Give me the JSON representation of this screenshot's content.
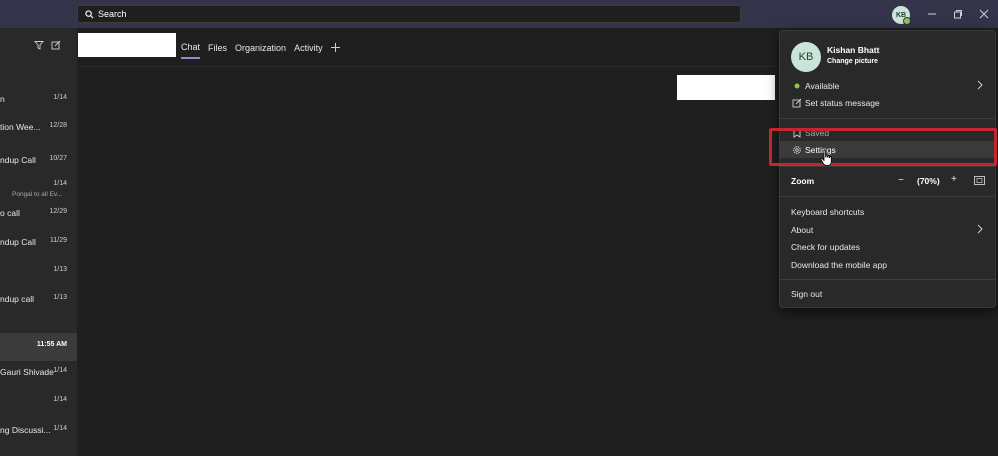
{
  "search": {
    "placeholder": "Search"
  },
  "header": {
    "avatar_initials": "KB"
  },
  "tabs": [
    {
      "label": "Chat",
      "active": true
    },
    {
      "label": "Files"
    },
    {
      "label": "Organization"
    },
    {
      "label": "Activity"
    }
  ],
  "chat_list": [
    {
      "name": "n",
      "date": "1/14"
    },
    {
      "name": "tion Wee...",
      "date": "12/28"
    },
    {
      "name": "ndup Call",
      "date": "10/27"
    },
    {
      "name": "",
      "date": "1/14",
      "preview": "Pongal to all Ev..."
    },
    {
      "name": "o call",
      "date": "12/29"
    },
    {
      "name": "ndup Call",
      "date": "11/29"
    },
    {
      "name": "",
      "date": "1/13"
    },
    {
      "name": "ndup call",
      "date": "1/13"
    },
    {
      "name": "",
      "date": "11:55 AM",
      "active": true
    },
    {
      "name": "Gauri Shivade",
      "date": "1/14"
    },
    {
      "name": "",
      "date": "1/14"
    },
    {
      "name": "ng Discussi...",
      "date": "1/14"
    }
  ],
  "profile_menu": {
    "avatar_initials": "KB",
    "user_name": "Kishan Bhatt",
    "change_picture": "Change picture",
    "status": "Available",
    "set_status": "Set status message",
    "saved": "Saved",
    "settings": "Settings",
    "zoom_label": "Zoom",
    "zoom_minus": "−",
    "zoom_value": "(70%)",
    "zoom_plus": "+",
    "keyboard_shortcuts": "Keyboard shortcuts",
    "about": "About",
    "check_updates": "Check for updates",
    "download_mobile": "Download the mobile app",
    "sign_out": "Sign out"
  },
  "colors": {
    "title_bar": "#33344a",
    "background": "#1f1f1f",
    "menu_bg": "#292929",
    "accent": "#8b8cc7",
    "available": "#92c353",
    "highlight_border": "#c4262e"
  }
}
